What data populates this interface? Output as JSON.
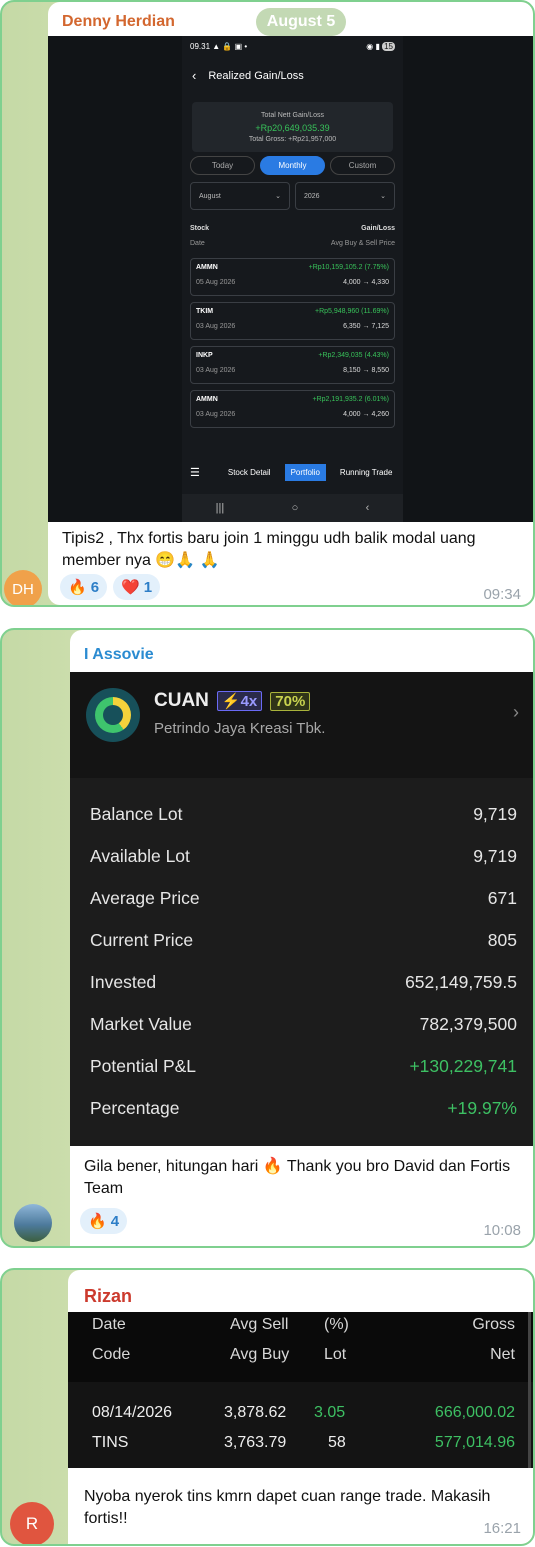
{
  "msg1": {
    "sender": "Denny Herdian",
    "date_chip": "August 5",
    "avatar_initials": "DH",
    "phone": {
      "status_time": "09.31",
      "status_icons": "▲ 🔒 ▣ •",
      "status_right": "15",
      "title": "Realized Gain/Loss",
      "total_label": "Total Nett Gain/Loss",
      "total_value": "+Rp20,649,035.39",
      "total_gross": "Total Gross: +Rp21,957,000",
      "tabs": [
        "Today",
        "Monthly",
        "Custom"
      ],
      "month": "August",
      "year": "2026",
      "col_stock": "Stock",
      "col_gain": "Gain/Loss",
      "col_date": "Date",
      "col_avg": "Avg Buy & Sell Price",
      "rows": [
        {
          "code": "AMMN",
          "gain": "+Rp10,159,105.2 (7.75%)",
          "date": "05 Aug 2026",
          "price": "4,000 → 4,330"
        },
        {
          "code": "TKIM",
          "gain": "+Rp5,948,960 (11.69%)",
          "date": "03 Aug 2026",
          "price": "6,350 → 7,125"
        },
        {
          "code": "INKP",
          "gain": "+Rp2,349,035 (4.43%)",
          "date": "03 Aug 2026",
          "price": "8,150 → 8,550"
        },
        {
          "code": "AMMN",
          "gain": "+Rp2,191,935.2 (6.01%)",
          "date": "03 Aug 2026",
          "price": "4,000 → 4,260"
        }
      ],
      "nav": [
        "Stock Detail",
        "Portfolio",
        "Running Trade"
      ]
    },
    "caption": "Tipis2 , Thx fortis baru join 1 minggu udh balik modal uang member nya 😁🙏 🙏",
    "reactions": [
      {
        "emoji": "🔥",
        "count": "6"
      },
      {
        "emoji": "❤️",
        "count": "1"
      }
    ],
    "time": "09:34"
  },
  "msg2": {
    "sender": "I Assovie",
    "ticker": "CUAN",
    "badge1": "⚡4x",
    "badge2": "70%",
    "company": "Petrindo Jaya Kreasi Tbk.",
    "rows": [
      {
        "label": "Balance Lot",
        "value": "9,719"
      },
      {
        "label": "Available Lot",
        "value": "9,719"
      },
      {
        "label": "Average Price",
        "value": "671"
      },
      {
        "label": "Current Price",
        "value": "805"
      },
      {
        "label": "Invested",
        "value": "652,149,759.5"
      },
      {
        "label": "Market Value",
        "value": "782,379,500"
      },
      {
        "label": "Potential P&L",
        "value": "+130,229,741"
      },
      {
        "label": "Percentage",
        "value": "+19.97%"
      }
    ],
    "caption": "Gila bener, hitungan hari 🔥 Thank you bro David dan Fortis Team",
    "reactions": [
      {
        "emoji": "🔥",
        "count": "4"
      }
    ],
    "time": "10:08"
  },
  "msg3": {
    "sender": "Rizan",
    "avatar_initials": "R",
    "table": {
      "h_date": "Date",
      "h_avgsell": "Avg Sell",
      "h_pct": "(%)",
      "h_gross": "Gross",
      "h_code": "Code",
      "h_avgbuy": "Avg Buy",
      "h_lot": "Lot",
      "h_net": "Net",
      "date": "08/14/2026",
      "avg_sell": "3,878.62",
      "pct": "3.05",
      "gross": "666,000.02",
      "code": "TINS",
      "avg_buy": "3,763.79",
      "lot": "58",
      "net": "577,014.96"
    },
    "caption": "Nyoba nyerok tins kmrn dapet cuan range trade. Makasih fortis!!",
    "time": "16:21"
  },
  "colors": {
    "green": "#3dc063",
    "accent_blue": "#2a7be3",
    "card_border": "#7fd08f"
  }
}
